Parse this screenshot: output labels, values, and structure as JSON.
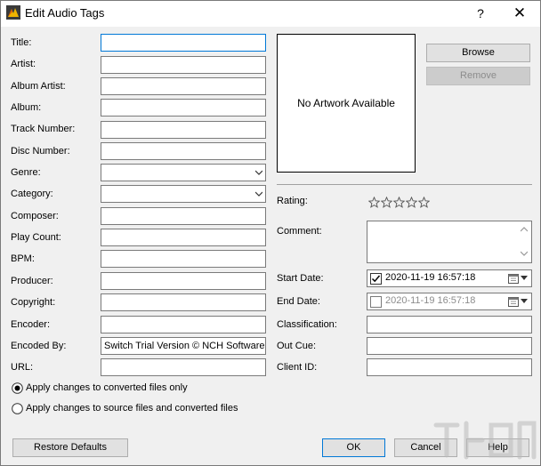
{
  "window": {
    "title": "Edit Audio Tags",
    "help_button": "?",
    "close_button": "✕"
  },
  "fields_left": [
    {
      "label": "Title:",
      "value": ""
    },
    {
      "label": "Artist:",
      "value": ""
    },
    {
      "label": "Album Artist:",
      "value": ""
    },
    {
      "label": "Album:",
      "value": ""
    },
    {
      "label": "Track Number:",
      "value": ""
    },
    {
      "label": "Disc Number:",
      "value": ""
    },
    {
      "label": "Genre:",
      "value": ""
    },
    {
      "label": "Category:",
      "value": ""
    },
    {
      "label": "Composer:",
      "value": ""
    },
    {
      "label": "Play Count:",
      "value": ""
    },
    {
      "label": "BPM:",
      "value": ""
    },
    {
      "label": "Producer:",
      "value": ""
    },
    {
      "label": "Copyright:",
      "value": ""
    },
    {
      "label": "Encoder:",
      "value": ""
    },
    {
      "label": "Encoded By:",
      "value": "Switch Trial Version © NCH Software"
    },
    {
      "label": "URL:",
      "value": ""
    }
  ],
  "artwork": {
    "placeholder": "No Artwork Available",
    "browse_label": "Browse",
    "remove_label": "Remove"
  },
  "rating": {
    "label": "Rating:",
    "stars": 0,
    "max": 5
  },
  "comment": {
    "label": "Comment:",
    "value": ""
  },
  "start_date": {
    "label": "Start Date:",
    "value": "2020-11-19 16:57:18",
    "checked": true
  },
  "end_date": {
    "label": "End Date:",
    "value": "2020-11-19 16:57:18",
    "checked": false
  },
  "fields_right": [
    {
      "label": "Classification:",
      "value": ""
    },
    {
      "label": "Out Cue:",
      "value": ""
    },
    {
      "label": "Client ID:",
      "value": ""
    }
  ],
  "apply_options": [
    {
      "label": "Apply changes to converted files only",
      "selected": true
    },
    {
      "label": "Apply changes to source files and converted files",
      "selected": false
    }
  ],
  "footer": {
    "restore_label": "Restore Defaults",
    "ok_label": "OK",
    "cancel_label": "Cancel",
    "help_label": "Help"
  },
  "colors": {
    "focus_border": "#0078d7",
    "background": "#f0f0f0"
  }
}
